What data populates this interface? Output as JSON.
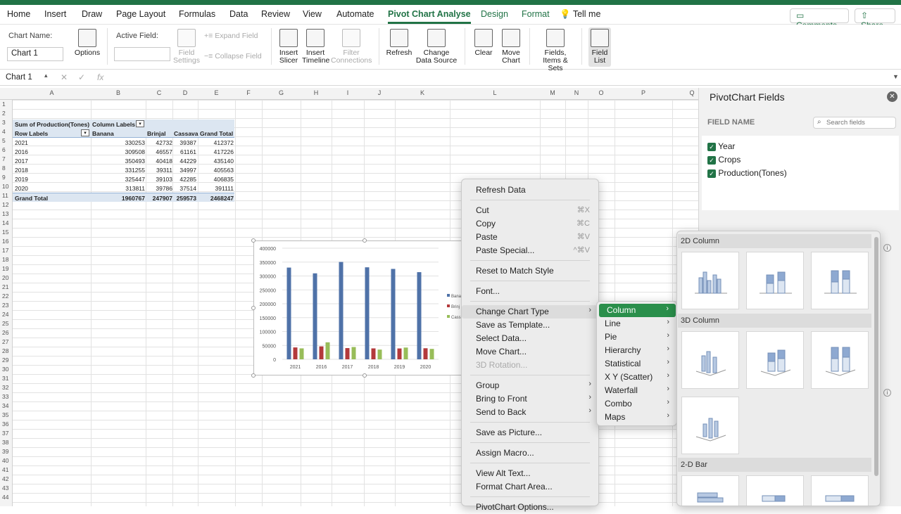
{
  "ribbon_tabs": [
    "Home",
    "Insert",
    "Draw",
    "Page Layout",
    "Formulas",
    "Data",
    "Review",
    "View",
    "Automate",
    "Pivot Chart Analyse",
    "Design",
    "Format"
  ],
  "tell_me": "Tell me",
  "comments_label": "Comments",
  "share_label": "Share",
  "ribbon": {
    "chart_name_label": "Chart Name:",
    "chart_name_value": "Chart 1",
    "options_label": "Options",
    "active_field_label": "Active Field:",
    "active_field_value": "",
    "field_settings_label": "Field Settings",
    "expand_field_label": "Expand Field",
    "collapse_field_label": "Collapse Field",
    "insert_slicer_label": "Insert Slicer",
    "insert_timeline_label": "Insert Timeline",
    "filter_connections_label": "Filter Connections",
    "refresh_label": "Refresh",
    "change_data_source_label": "Change Data Source",
    "clear_label": "Clear",
    "move_chart_label": "Move Chart",
    "fields_items_sets_label": "Fields, Items & Sets",
    "field_list_label": "Field List"
  },
  "formula_bar": {
    "name_box": "Chart 1",
    "fx": "fx"
  },
  "columns": [
    "A",
    "B",
    "C",
    "D",
    "E",
    "F",
    "G",
    "H",
    "I",
    "J",
    "K",
    "L",
    "M",
    "N",
    "O",
    "P",
    "Q"
  ],
  "row_numbers": [
    "1",
    "2",
    "3",
    "4",
    "5",
    "6",
    "7",
    "8",
    "9",
    "10",
    "11",
    "12",
    "13",
    "14",
    "15",
    "16",
    "17",
    "18",
    "19",
    "20",
    "21",
    "22",
    "23",
    "24",
    "25",
    "26",
    "27",
    "28",
    "29",
    "30",
    "31",
    "32",
    "33",
    "34",
    "35",
    "36",
    "37",
    "38",
    "39",
    "40",
    "41",
    "42",
    "43",
    "44"
  ],
  "pivot": {
    "title": "Sum of Production(Tones)",
    "column_labels": "Column Labels",
    "row_labels": "Row Labels",
    "headers": [
      "Banana",
      "Brinjal",
      "Cassava",
      "Grand Total"
    ],
    "rows": [
      {
        "label": "2021",
        "values": [
          "330253",
          "42732",
          "39387",
          "412372"
        ]
      },
      {
        "label": "2016",
        "values": [
          "309508",
          "46557",
          "61161",
          "417226"
        ]
      },
      {
        "label": "2017",
        "values": [
          "350493",
          "40418",
          "44229",
          "435140"
        ]
      },
      {
        "label": "2018",
        "values": [
          "331255",
          "39311",
          "34997",
          "405563"
        ]
      },
      {
        "label": "2019",
        "values": [
          "325447",
          "39103",
          "42285",
          "406835"
        ]
      },
      {
        "label": "2020",
        "values": [
          "313811",
          "39786",
          "37514",
          "391111"
        ]
      }
    ],
    "total": {
      "label": "Grand Total",
      "values": [
        "1960767",
        "247907",
        "259573",
        "2468247"
      ]
    }
  },
  "chart_data": {
    "type": "bar",
    "categories": [
      "2021",
      "2016",
      "2017",
      "2018",
      "2019",
      "2020"
    ],
    "series": [
      {
        "name": "Banana",
        "values": [
          330253,
          309508,
          350493,
          331255,
          325447,
          313811
        ],
        "color": "#4f72a8"
      },
      {
        "name": "Brinjal",
        "values": [
          42732,
          46557,
          40418,
          39311,
          39103,
          39786
        ],
        "color": "#b3393b"
      },
      {
        "name": "Cassava",
        "values": [
          39387,
          61161,
          44229,
          34997,
          42285,
          37514
        ],
        "color": "#98bd59"
      }
    ],
    "ylim": [
      0,
      400000
    ],
    "yticks": [
      "400000",
      "350000",
      "300000",
      "250000",
      "200000",
      "150000",
      "100000",
      "50000",
      "0"
    ],
    "legend_position": "right",
    "legend_labels": [
      "Bana",
      "Brinj",
      "Cass"
    ],
    "grid": true
  },
  "context_menu": {
    "items": [
      {
        "label": "Refresh Data"
      },
      {
        "label": "Cut",
        "shortcut": "⌘X"
      },
      {
        "label": "Copy",
        "shortcut": "⌘C"
      },
      {
        "label": "Paste",
        "shortcut": "⌘V"
      },
      {
        "label": "Paste Special...",
        "shortcut": "^⌘V"
      },
      {
        "label": "Reset to Match Style"
      },
      {
        "label": "Font..."
      },
      {
        "label": "Change Chart Type"
      },
      {
        "label": "Save as Template..."
      },
      {
        "label": "Select Data..."
      },
      {
        "label": "Move Chart..."
      },
      {
        "label": "3D Rotation..."
      },
      {
        "label": "Group"
      },
      {
        "label": "Bring to Front"
      },
      {
        "label": "Send to Back"
      },
      {
        "label": "Save as Picture..."
      },
      {
        "label": "Assign Macro..."
      },
      {
        "label": "View Alt Text..."
      },
      {
        "label": "Format Chart Area..."
      },
      {
        "label": "PivotChart Options..."
      }
    ]
  },
  "submenu": {
    "items": [
      "Column",
      "Line",
      "Pie",
      "Hierarchy",
      "Statistical",
      "X Y (Scatter)",
      "Waterfall",
      "Combo",
      "Maps"
    ]
  },
  "gallery": {
    "sections": [
      "2D Column",
      "3D Column",
      "2-D Bar"
    ]
  },
  "field_panel": {
    "title": "PivotChart Fields",
    "field_name_label": "FIELD NAME",
    "search_placeholder": "Search fields",
    "fields": [
      "Year",
      "Crops",
      "Production(Tones)"
    ]
  }
}
